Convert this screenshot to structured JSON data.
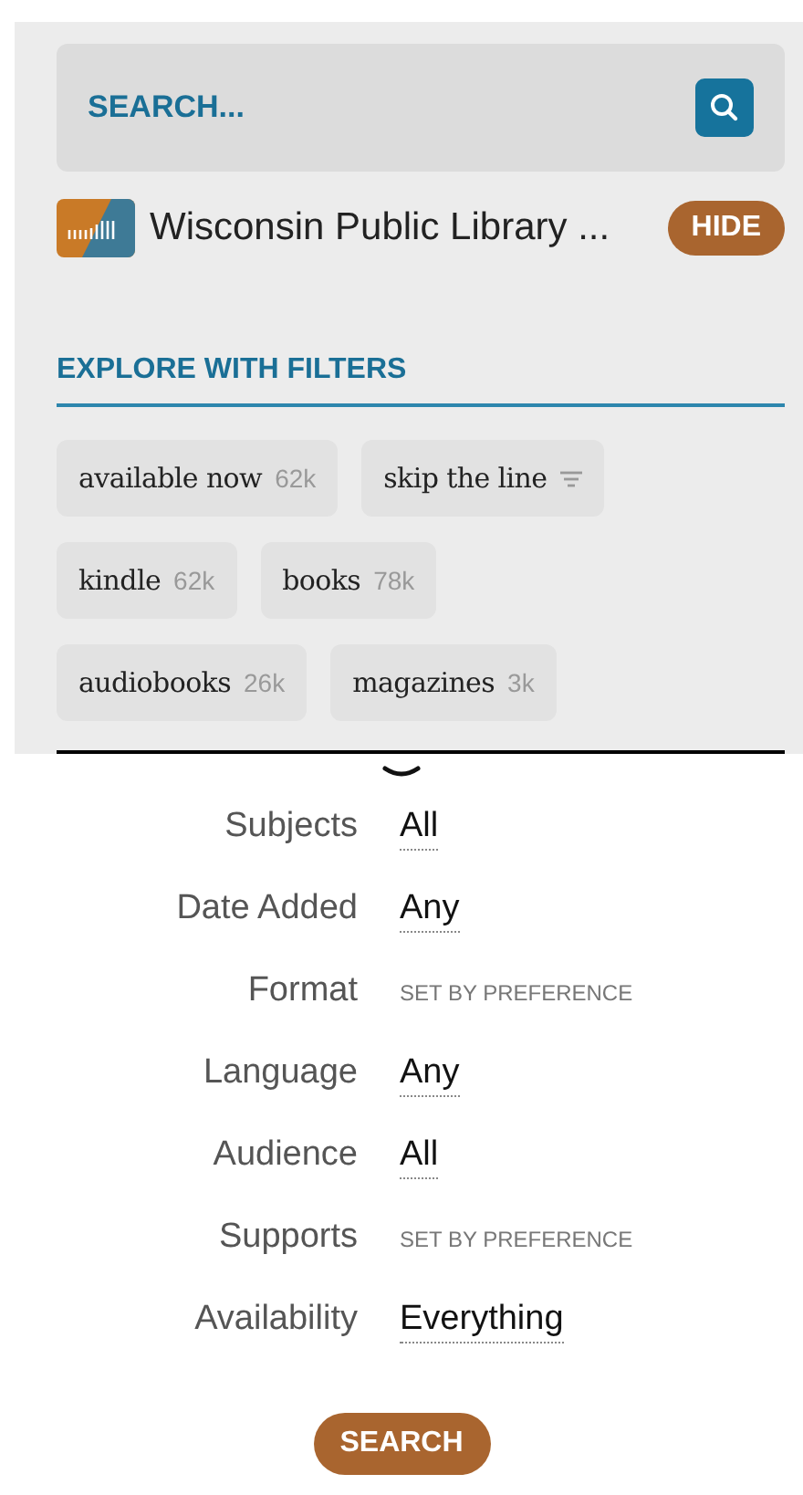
{
  "search": {
    "placeholder": "SEARCH..."
  },
  "library": {
    "name": "Wisconsin Public Library ...",
    "hide_label": "HIDE"
  },
  "explore": {
    "title": "EXPLORE WITH FILTERS",
    "chip_rows": [
      [
        {
          "kind": "count",
          "label": "available now",
          "count": "62k"
        },
        {
          "kind": "sort",
          "label": "skip the line"
        }
      ],
      [
        {
          "kind": "count",
          "label": "kindle",
          "count": "62k"
        },
        {
          "kind": "count",
          "label": "books",
          "count": "78k"
        }
      ],
      [
        {
          "kind": "count",
          "label": "audiobooks",
          "count": "26k"
        },
        {
          "kind": "count",
          "label": "magazines",
          "count": "3k"
        }
      ]
    ]
  },
  "filters": [
    {
      "label": "Subjects",
      "kind": "value",
      "value": "All"
    },
    {
      "label": "Date Added",
      "kind": "value",
      "value": "Any"
    },
    {
      "label": "Format",
      "kind": "preference",
      "value": "SET BY PREFERENCE"
    },
    {
      "label": "Language",
      "kind": "value",
      "value": "Any"
    },
    {
      "label": "Audience",
      "kind": "value",
      "value": "All"
    },
    {
      "label": "Supports",
      "kind": "preference",
      "value": "SET BY PREFERENCE"
    },
    {
      "label": "Availability",
      "kind": "value",
      "value": "Everything"
    }
  ],
  "search_button": "SEARCH"
}
